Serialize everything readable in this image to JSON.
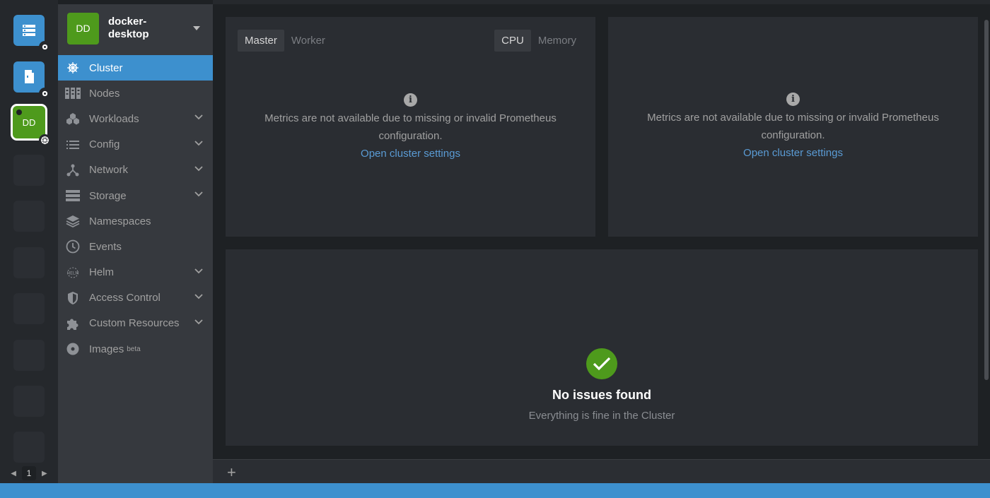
{
  "hotbar": {
    "cluster_short": "DD",
    "page": "1"
  },
  "cluster": {
    "avatar": "DD",
    "name": "docker-desktop"
  },
  "nav": [
    {
      "label": "Cluster",
      "icon": "helm-wheel-icon",
      "active": true,
      "expandable": false
    },
    {
      "label": "Nodes",
      "icon": "nodes-icon",
      "active": false,
      "expandable": false
    },
    {
      "label": "Workloads",
      "icon": "workloads-icon",
      "active": false,
      "expandable": true
    },
    {
      "label": "Config",
      "icon": "config-list-icon",
      "active": false,
      "expandable": true
    },
    {
      "label": "Network",
      "icon": "network-icon",
      "active": false,
      "expandable": true
    },
    {
      "label": "Storage",
      "icon": "storage-icon",
      "active": false,
      "expandable": true
    },
    {
      "label": "Namespaces",
      "icon": "layers-icon",
      "active": false,
      "expandable": false
    },
    {
      "label": "Events",
      "icon": "clock-icon",
      "active": false,
      "expandable": false
    },
    {
      "label": "Helm",
      "icon": "helm-icon",
      "active": false,
      "expandable": true
    },
    {
      "label": "Access Control",
      "icon": "shield-icon",
      "active": false,
      "expandable": true
    },
    {
      "label": "Custom Resources",
      "icon": "puzzle-icon",
      "active": false,
      "expandable": true
    },
    {
      "label": "Images",
      "icon": "disc-icon",
      "active": false,
      "expandable": false,
      "badge": "beta"
    }
  ],
  "metrics_left": {
    "tabs_role": [
      "Master",
      "Worker"
    ],
    "tabs_metric": [
      "CPU",
      "Memory"
    ],
    "message": "Metrics are not available due to missing or invalid Prometheus configuration.",
    "link": "Open cluster settings"
  },
  "metrics_right": {
    "message": "Metrics are not available due to missing or invalid Prometheus configuration.",
    "link": "Open cluster settings"
  },
  "issues": {
    "title": "No issues found",
    "subtitle": "Everything is fine in the Cluster"
  },
  "dock": {
    "add_label": "+"
  },
  "colors": {
    "accent": "#3d90ce",
    "cluster_green": "#4e9a1c",
    "sidebar_bg": "#36393e",
    "panel_bg": "#2a2d32"
  }
}
